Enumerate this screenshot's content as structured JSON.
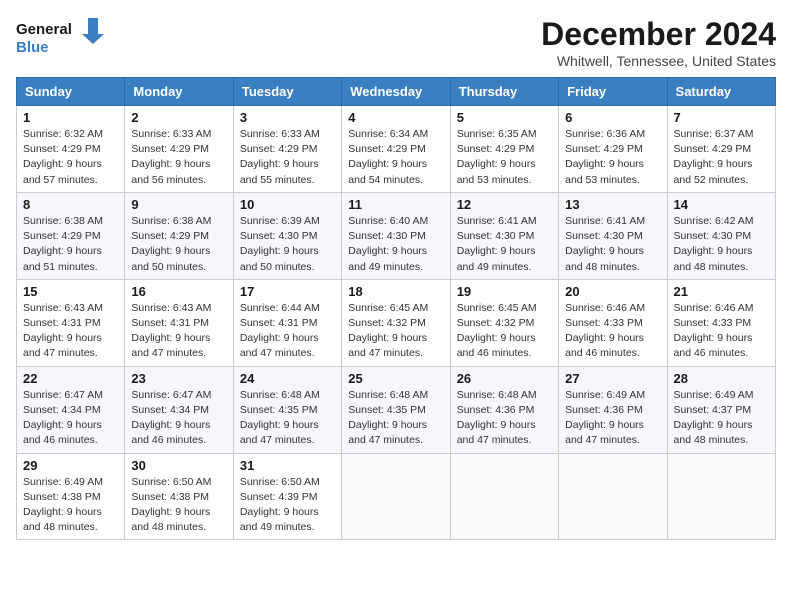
{
  "header": {
    "logo_line1": "General",
    "logo_line2": "Blue",
    "title": "December 2024",
    "location": "Whitwell, Tennessee, United States"
  },
  "days_of_week": [
    "Sunday",
    "Monday",
    "Tuesday",
    "Wednesday",
    "Thursday",
    "Friday",
    "Saturday"
  ],
  "weeks": [
    [
      {
        "day": 1,
        "sunrise": "6:32 AM",
        "sunset": "4:29 PM",
        "daylight": "9 hours and 57 minutes."
      },
      {
        "day": 2,
        "sunrise": "6:33 AM",
        "sunset": "4:29 PM",
        "daylight": "9 hours and 56 minutes."
      },
      {
        "day": 3,
        "sunrise": "6:33 AM",
        "sunset": "4:29 PM",
        "daylight": "9 hours and 55 minutes."
      },
      {
        "day": 4,
        "sunrise": "6:34 AM",
        "sunset": "4:29 PM",
        "daylight": "9 hours and 54 minutes."
      },
      {
        "day": 5,
        "sunrise": "6:35 AM",
        "sunset": "4:29 PM",
        "daylight": "9 hours and 53 minutes."
      },
      {
        "day": 6,
        "sunrise": "6:36 AM",
        "sunset": "4:29 PM",
        "daylight": "9 hours and 53 minutes."
      },
      {
        "day": 7,
        "sunrise": "6:37 AM",
        "sunset": "4:29 PM",
        "daylight": "9 hours and 52 minutes."
      }
    ],
    [
      {
        "day": 8,
        "sunrise": "6:38 AM",
        "sunset": "4:29 PM",
        "daylight": "9 hours and 51 minutes."
      },
      {
        "day": 9,
        "sunrise": "6:38 AM",
        "sunset": "4:29 PM",
        "daylight": "9 hours and 50 minutes."
      },
      {
        "day": 10,
        "sunrise": "6:39 AM",
        "sunset": "4:30 PM",
        "daylight": "9 hours and 50 minutes."
      },
      {
        "day": 11,
        "sunrise": "6:40 AM",
        "sunset": "4:30 PM",
        "daylight": "9 hours and 49 minutes."
      },
      {
        "day": 12,
        "sunrise": "6:41 AM",
        "sunset": "4:30 PM",
        "daylight": "9 hours and 49 minutes."
      },
      {
        "day": 13,
        "sunrise": "6:41 AM",
        "sunset": "4:30 PM",
        "daylight": "9 hours and 48 minutes."
      },
      {
        "day": 14,
        "sunrise": "6:42 AM",
        "sunset": "4:30 PM",
        "daylight": "9 hours and 48 minutes."
      }
    ],
    [
      {
        "day": 15,
        "sunrise": "6:43 AM",
        "sunset": "4:31 PM",
        "daylight": "9 hours and 47 minutes."
      },
      {
        "day": 16,
        "sunrise": "6:43 AM",
        "sunset": "4:31 PM",
        "daylight": "9 hours and 47 minutes."
      },
      {
        "day": 17,
        "sunrise": "6:44 AM",
        "sunset": "4:31 PM",
        "daylight": "9 hours and 47 minutes."
      },
      {
        "day": 18,
        "sunrise": "6:45 AM",
        "sunset": "4:32 PM",
        "daylight": "9 hours and 47 minutes."
      },
      {
        "day": 19,
        "sunrise": "6:45 AM",
        "sunset": "4:32 PM",
        "daylight": "9 hours and 46 minutes."
      },
      {
        "day": 20,
        "sunrise": "6:46 AM",
        "sunset": "4:33 PM",
        "daylight": "9 hours and 46 minutes."
      },
      {
        "day": 21,
        "sunrise": "6:46 AM",
        "sunset": "4:33 PM",
        "daylight": "9 hours and 46 minutes."
      }
    ],
    [
      {
        "day": 22,
        "sunrise": "6:47 AM",
        "sunset": "4:34 PM",
        "daylight": "9 hours and 46 minutes."
      },
      {
        "day": 23,
        "sunrise": "6:47 AM",
        "sunset": "4:34 PM",
        "daylight": "9 hours and 46 minutes."
      },
      {
        "day": 24,
        "sunrise": "6:48 AM",
        "sunset": "4:35 PM",
        "daylight": "9 hours and 47 minutes."
      },
      {
        "day": 25,
        "sunrise": "6:48 AM",
        "sunset": "4:35 PM",
        "daylight": "9 hours and 47 minutes."
      },
      {
        "day": 26,
        "sunrise": "6:48 AM",
        "sunset": "4:36 PM",
        "daylight": "9 hours and 47 minutes."
      },
      {
        "day": 27,
        "sunrise": "6:49 AM",
        "sunset": "4:36 PM",
        "daylight": "9 hours and 47 minutes."
      },
      {
        "day": 28,
        "sunrise": "6:49 AM",
        "sunset": "4:37 PM",
        "daylight": "9 hours and 48 minutes."
      }
    ],
    [
      {
        "day": 29,
        "sunrise": "6:49 AM",
        "sunset": "4:38 PM",
        "daylight": "9 hours and 48 minutes."
      },
      {
        "day": 30,
        "sunrise": "6:50 AM",
        "sunset": "4:38 PM",
        "daylight": "9 hours and 48 minutes."
      },
      {
        "day": 31,
        "sunrise": "6:50 AM",
        "sunset": "4:39 PM",
        "daylight": "9 hours and 49 minutes."
      },
      null,
      null,
      null,
      null
    ]
  ]
}
